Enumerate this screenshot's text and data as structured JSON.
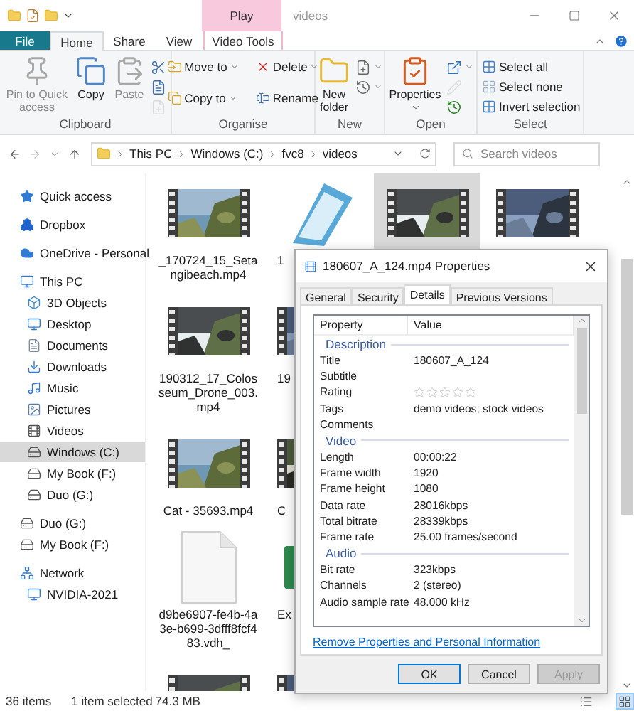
{
  "window": {
    "title": "videos",
    "context_header": "Play"
  },
  "ribbon_tabs": [
    {
      "label": "File",
      "kind": "file",
      "selected": false
    },
    {
      "label": "Home",
      "kind": "tab",
      "selected": true
    },
    {
      "label": "Share",
      "kind": "tab",
      "selected": false
    },
    {
      "label": "View",
      "kind": "tab",
      "selected": false
    },
    {
      "label": "Video Tools",
      "kind": "context",
      "selected": false
    }
  ],
  "ribbon_groups": [
    {
      "label": "Clipboard",
      "items": [
        {
          "kind": "large",
          "label": "Pin to Quick access",
          "disabled": true
        },
        {
          "kind": "large",
          "label": "Copy",
          "disabled": false
        },
        {
          "kind": "large",
          "label": "Paste",
          "disabled": true
        },
        {
          "kind": "icon",
          "disabled": false
        },
        {
          "kind": "icon",
          "disabled": false
        },
        {
          "kind": "icon",
          "disabled": true
        }
      ]
    },
    {
      "label": "Organise",
      "items": [
        {
          "kind": "small",
          "label": "Move to",
          "dropdown": true,
          "disabled": false
        },
        {
          "kind": "small",
          "label": "Copy to",
          "dropdown": true,
          "disabled": false
        },
        {
          "kind": "small",
          "label": "Delete",
          "dropdown": true,
          "disabled": false
        },
        {
          "kind": "small",
          "label": "Rename",
          "dropdown": false,
          "disabled": false
        }
      ]
    },
    {
      "label": "New",
      "items": [
        {
          "kind": "large",
          "label": "New folder",
          "disabled": false
        },
        {
          "kind": "icon",
          "dropdown": true,
          "disabled": false
        },
        {
          "kind": "icon",
          "dropdown": true,
          "disabled": false
        }
      ]
    },
    {
      "label": "Open",
      "items": [
        {
          "kind": "large",
          "label": "Properties",
          "dropdown": true,
          "disabled": false
        },
        {
          "kind": "icon",
          "dropdown": true,
          "disabled": false
        },
        {
          "kind": "icon",
          "disabled": true
        },
        {
          "kind": "icon",
          "disabled": false
        }
      ]
    },
    {
      "label": "Select",
      "items": [
        {
          "kind": "small",
          "label": "Select all",
          "disabled": false
        },
        {
          "kind": "small",
          "label": "Select none",
          "disabled": false
        },
        {
          "kind": "small",
          "label": "Invert selection",
          "disabled": false
        }
      ]
    }
  ],
  "address": {
    "path": [
      "This PC",
      "Windows (C:)",
      "fvc8",
      "videos"
    ]
  },
  "search": {
    "placeholder": "Search videos"
  },
  "sidebar": {
    "items": [
      {
        "label": "Quick access",
        "selected": false
      },
      {
        "label": "Dropbox",
        "selected": false
      },
      {
        "label": "OneDrive - Personal",
        "selected": false
      },
      {
        "label": "This PC",
        "selected": false,
        "children": [
          {
            "label": "3D Objects",
            "selected": false
          },
          {
            "label": "Desktop",
            "selected": false
          },
          {
            "label": "Documents",
            "selected": false
          },
          {
            "label": "Downloads",
            "selected": false
          },
          {
            "label": "Music",
            "selected": false
          },
          {
            "label": "Pictures",
            "selected": false
          },
          {
            "label": "Videos",
            "selected": false
          },
          {
            "label": "Windows (C:)",
            "selected": true
          },
          {
            "label": "My Book (F:)",
            "selected": false
          },
          {
            "label": "Duo (G:)",
            "selected": false
          }
        ]
      },
      {
        "label": "Duo (G:)",
        "selected": false
      },
      {
        "label": "My Book (F:)",
        "selected": false
      },
      {
        "label": "Network",
        "selected": false,
        "children": [
          {
            "label": "NVIDIA-2021",
            "selected": false
          }
        ]
      }
    ]
  },
  "file_rows": [
    {
      "items": [
        {
          "name": "_170724_15_Setangibeach.mp4",
          "kind": "video",
          "selected": false
        },
        {
          "name": "1",
          "kind": "document",
          "selected": false
        },
        {
          "kind": "video",
          "selected": true
        },
        {
          "kind": "video",
          "selected": false
        }
      ]
    },
    {
      "items": [
        {
          "name": "190312_17_Colosseum_Drone_003.mp4",
          "kind": "video",
          "selected": false
        },
        {
          "name": "19",
          "kind": "video",
          "selected": false
        }
      ]
    },
    {
      "items": [
        {
          "name": "Cat - 35693.mp4",
          "kind": "video",
          "selected": false
        },
        {
          "name": "C",
          "kind": "video",
          "selected": false
        }
      ]
    },
    {
      "items": [
        {
          "name": "d9be6907-fe4b-4a3e-b699-3dfff8fcf483.vdh_",
          "kind": "blank",
          "selected": false
        },
        {
          "name": "Ex",
          "kind": "app",
          "selected": false
        }
      ]
    },
    {
      "items": [
        {
          "kind": "video",
          "selected": false
        },
        {
          "kind": "video",
          "selected": false
        }
      ]
    }
  ],
  "properties_dialog": {
    "title": "180607_A_124.mp4 Properties",
    "tabs": [
      {
        "label": "General",
        "selected": false
      },
      {
        "label": "Security",
        "selected": false
      },
      {
        "label": "Details",
        "selected": true
      },
      {
        "label": "Previous Versions",
        "selected": false
      }
    ],
    "columns": [
      "Property",
      "Value"
    ],
    "sections": [
      {
        "heading": "Description",
        "rows": [
          {
            "kind": "text",
            "property": "Title",
            "value": "180607_A_124"
          },
          {
            "kind": "text",
            "property": "Subtitle"
          },
          {
            "kind": "stars",
            "property": "Rating",
            "stars": 0
          },
          {
            "kind": "text",
            "property": "Tags",
            "value": "demo videos; stock videos"
          },
          {
            "kind": "text",
            "property": "Comments"
          }
        ]
      },
      {
        "heading": "Video",
        "rows": [
          {
            "kind": "text",
            "property": "Length",
            "value": "00:00:22"
          },
          {
            "kind": "text",
            "property": "Frame width",
            "value": "1920"
          },
          {
            "kind": "text",
            "property": "Frame height",
            "value": "1080"
          },
          {
            "kind": "text",
            "property": "Data rate",
            "value": "28016kbps"
          },
          {
            "kind": "text",
            "property": "Total bitrate",
            "value": "28339kbps"
          },
          {
            "kind": "text",
            "property": "Frame rate",
            "value": "25.00 frames/second"
          }
        ]
      },
      {
        "heading": "Audio",
        "rows": [
          {
            "kind": "text",
            "property": "Bit rate",
            "value": "323kbps"
          },
          {
            "kind": "text",
            "property": "Channels",
            "value": "2 (stereo)"
          },
          {
            "kind": "text",
            "property": "Audio sample rate",
            "value": "48.000 kHz"
          }
        ]
      }
    ],
    "link": "Remove Properties and Personal Information",
    "buttons": [
      {
        "label": "OK",
        "kind": "default",
        "disabled": false
      },
      {
        "label": "Cancel",
        "kind": "normal",
        "disabled": false
      },
      {
        "label": "Apply",
        "kind": "normal",
        "disabled": true
      }
    ]
  },
  "status_bar": {
    "count": "36 items",
    "selection": "1 item selected",
    "size": "74.3 MB",
    "views": [
      {
        "kind": "details",
        "selected": false
      },
      {
        "kind": "icons",
        "selected": true
      }
    ]
  }
}
